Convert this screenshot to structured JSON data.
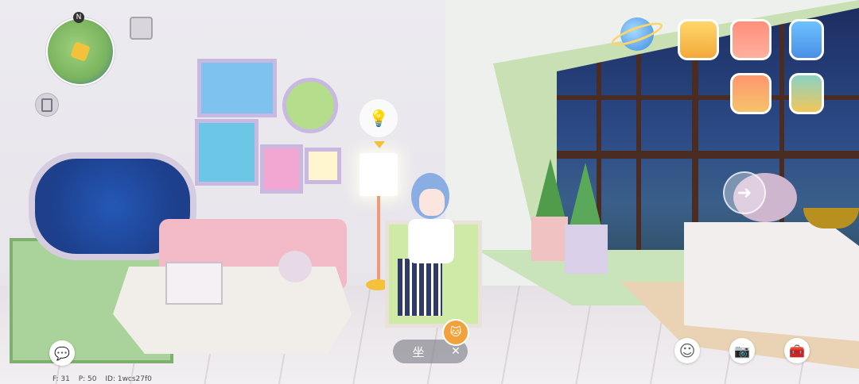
{
  "hud": {
    "minimap_label": "minimap",
    "compass_glyph": "N",
    "action_sit_label": "坐",
    "action_cancel_glyph": "✕"
  },
  "icons": {
    "top_right": [
      "planet-icon",
      "gift-icon",
      "shopping-basket-icon",
      "phone-icon",
      "house-icon",
      "backpack-icon"
    ],
    "bottom_right": [
      "emote-icon",
      "camera-icon",
      "toolbox-icon"
    ],
    "bottom_left": [
      "chat-icon"
    ]
  },
  "stats": {
    "fps": "F: 31",
    "ping": "P: 50",
    "id": "ID: 1wcs27f0"
  },
  "colors": {
    "accent_yellow": "#f4c23a",
    "pet_badge": "#f2a23c",
    "window_sky": "#1c2e62",
    "sill_green": "#c9e3bb"
  }
}
